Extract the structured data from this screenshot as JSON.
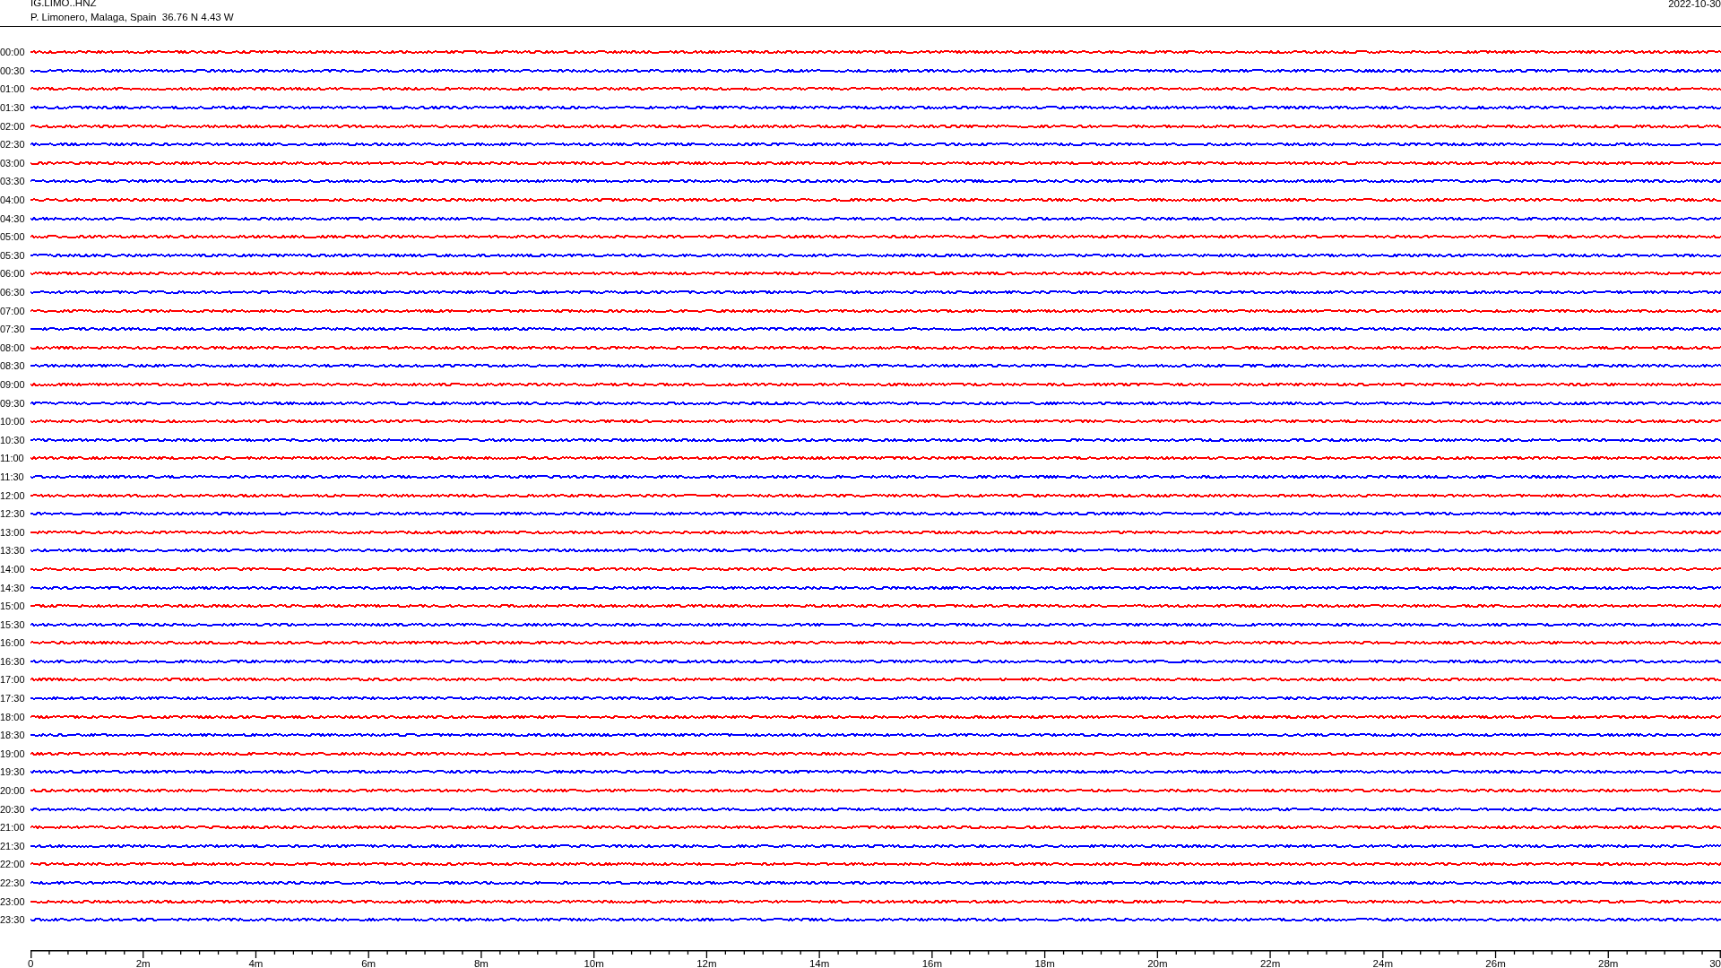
{
  "header": {
    "station": "IG.LIMO..HNZ",
    "location": "P. Limonero, Malaga, Spain  36.76 N 4.43 W",
    "date": "2022-10-30"
  },
  "rows": [
    {
      "time": "00:00",
      "color": "#ff0000"
    },
    {
      "time": "00:30",
      "color": "#0000ff"
    },
    {
      "time": "01:00",
      "color": "#ff0000"
    },
    {
      "time": "01:30",
      "color": "#0000ff"
    },
    {
      "time": "02:00",
      "color": "#ff0000"
    },
    {
      "time": "02:30",
      "color": "#0000ff"
    },
    {
      "time": "03:00",
      "color": "#ff0000"
    },
    {
      "time": "03:30",
      "color": "#0000ff"
    },
    {
      "time": "04:00",
      "color": "#ff0000"
    },
    {
      "time": "04:30",
      "color": "#0000ff"
    },
    {
      "time": "05:00",
      "color": "#ff0000"
    },
    {
      "time": "05:30",
      "color": "#0000ff"
    },
    {
      "time": "06:00",
      "color": "#ff0000"
    },
    {
      "time": "06:30",
      "color": "#0000ff"
    },
    {
      "time": "07:00",
      "color": "#ff0000"
    },
    {
      "time": "07:30",
      "color": "#0000ff"
    },
    {
      "time": "08:00",
      "color": "#ff0000"
    },
    {
      "time": "08:30",
      "color": "#0000ff"
    },
    {
      "time": "09:00",
      "color": "#ff0000"
    },
    {
      "time": "09:30",
      "color": "#0000ff"
    },
    {
      "time": "10:00",
      "color": "#ff0000"
    },
    {
      "time": "10:30",
      "color": "#0000ff"
    },
    {
      "time": "11:00",
      "color": "#ff0000"
    },
    {
      "time": "11:30",
      "color": "#0000ff"
    },
    {
      "time": "12:00",
      "color": "#ff0000"
    },
    {
      "time": "12:30",
      "color": "#0000ff"
    },
    {
      "time": "13:00",
      "color": "#ff0000"
    },
    {
      "time": "13:30",
      "color": "#0000ff"
    },
    {
      "time": "14:00",
      "color": "#ff0000"
    },
    {
      "time": "14:30",
      "color": "#0000ff"
    },
    {
      "time": "15:00",
      "color": "#ff0000"
    },
    {
      "time": "15:30",
      "color": "#0000ff"
    },
    {
      "time": "16:00",
      "color": "#ff0000"
    },
    {
      "time": "16:30",
      "color": "#0000ff"
    },
    {
      "time": "17:00",
      "color": "#ff0000"
    },
    {
      "time": "17:30",
      "color": "#0000ff"
    },
    {
      "time": "18:00",
      "color": "#ff0000"
    },
    {
      "time": "18:30",
      "color": "#0000ff"
    },
    {
      "time": "19:00",
      "color": "#ff0000"
    },
    {
      "time": "19:30",
      "color": "#0000ff"
    },
    {
      "time": "20:00",
      "color": "#ff0000"
    },
    {
      "time": "20:30",
      "color": "#0000ff"
    },
    {
      "time": "21:00",
      "color": "#ff0000"
    },
    {
      "time": "21:30",
      "color": "#0000ff"
    },
    {
      "time": "22:00",
      "color": "#ff0000"
    },
    {
      "time": "22:30",
      "color": "#0000ff"
    },
    {
      "time": "23:00",
      "color": "#ff0000"
    },
    {
      "time": "23:30",
      "color": "#0000ff"
    }
  ],
  "axis": {
    "labels": [
      "0",
      "2m",
      "4m",
      "6m",
      "8m",
      "10m",
      "12m",
      "14m",
      "16m",
      "18m",
      "20m",
      "22m",
      "24m",
      "26m",
      "28m",
      "30"
    ]
  }
}
